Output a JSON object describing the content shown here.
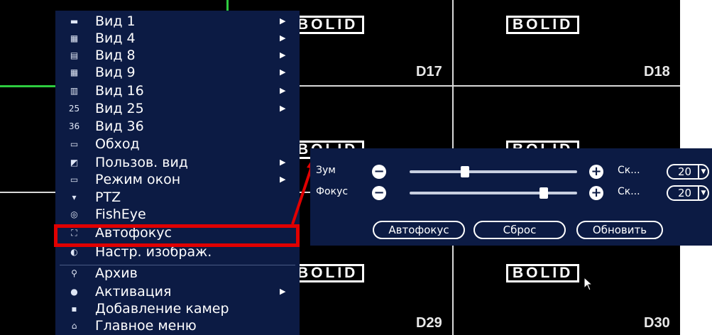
{
  "cameras": {
    "logo": "BOLID",
    "d17": "D17",
    "d18": "D18",
    "d29": "D29",
    "d30": "D30"
  },
  "menu": {
    "items": [
      {
        "label": "Вид 1",
        "icon": "grid-1-icon",
        "glyph": "▬",
        "submenu": true
      },
      {
        "label": "Вид 4",
        "icon": "grid-4-icon",
        "glyph": "▦",
        "submenu": true
      },
      {
        "label": "Вид 8",
        "icon": "grid-8-icon",
        "glyph": "▤",
        "submenu": true
      },
      {
        "label": "Вид 9",
        "icon": "grid-9-icon",
        "glyph": "▦",
        "submenu": true
      },
      {
        "label": "Вид 16",
        "icon": "grid-16-icon",
        "glyph": "▥",
        "submenu": true
      },
      {
        "label": "Вид 25",
        "icon": "grid-25-icon",
        "glyph": "25",
        "submenu": true
      },
      {
        "label": "Вид 36",
        "icon": "grid-36-icon",
        "glyph": "36",
        "submenu": false
      },
      {
        "label": "Обход",
        "icon": "sequence-icon",
        "glyph": "▭",
        "submenu": false
      },
      {
        "label": "Пользов. вид",
        "icon": "custom-view-icon",
        "glyph": "◩",
        "submenu": true
      },
      {
        "label": "Режим окон",
        "icon": "monitor-icon",
        "glyph": "▭",
        "submenu": true
      },
      {
        "label": "PTZ",
        "icon": "ptz-camera-icon",
        "glyph": "▾",
        "submenu": false
      },
      {
        "label": "FishEye",
        "icon": "fisheye-icon",
        "glyph": "◎",
        "submenu": false
      },
      {
        "label": "Автофокус",
        "icon": "autofocus-icon",
        "glyph": "⛶",
        "submenu": false
      },
      {
        "label": "Настр. изображ.",
        "icon": "image-settings-icon",
        "glyph": "◐",
        "submenu": false
      },
      {
        "label": "Архив",
        "icon": "search-icon",
        "glyph": "⚲",
        "submenu": false
      },
      {
        "label": "Активация",
        "icon": "activation-icon",
        "glyph": "●",
        "submenu": true
      },
      {
        "label": "Добавление камер",
        "icon": "add-camera-icon",
        "glyph": "▪",
        "submenu": false
      },
      {
        "label": "Главное меню",
        "icon": "home-icon",
        "glyph": "⌂",
        "submenu": false
      }
    ]
  },
  "popup": {
    "zoom_label": "Зум",
    "focus_label": "Фокус",
    "speed_label": "Ск...",
    "zoom_speed": "20",
    "focus_speed": "20",
    "zoom_level": 0.33,
    "focus_level": 0.8,
    "autofocus_button": "Автофокус",
    "reset_button": "Сброс",
    "refresh_button": "Обновить"
  },
  "colors": {
    "menu_bg": "#0c1b44",
    "highlight": "#e00000",
    "arrow": "#e00000"
  }
}
